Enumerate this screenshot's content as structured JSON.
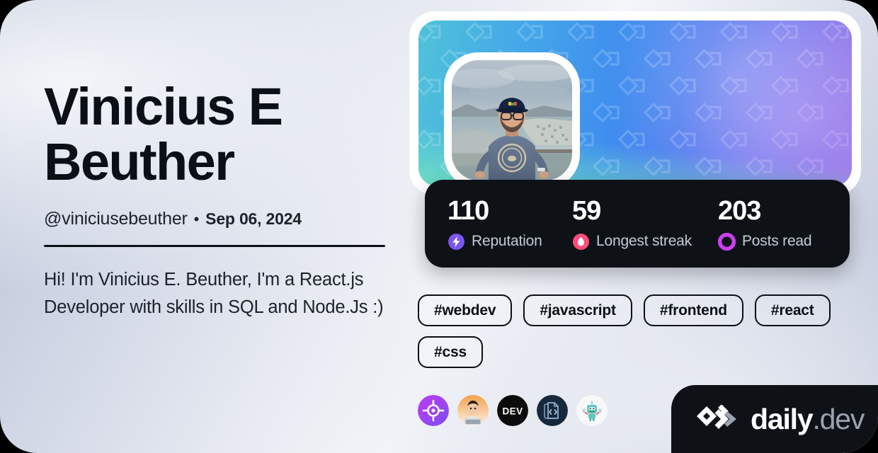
{
  "profile": {
    "name": "Vinicius E Beuther",
    "handle": "@viniciusebeuther",
    "separator": "•",
    "joined_date": "Sep 06, 2024",
    "bio": "Hi! I'm Vinicius E. Beuther, I'm a React.js Developer with skills in SQL and Node.Js :)"
  },
  "stats": [
    {
      "value": "110",
      "label": "Reputation",
      "icon": "reputation-bolt-icon",
      "color": "#7B55F0"
    },
    {
      "value": "59",
      "label": "Longest streak",
      "icon": "streak-flame-icon",
      "color": "#FF4C79"
    },
    {
      "value": "203",
      "label": "Posts read",
      "icon": "posts-read-ring-icon",
      "color": "#CE3DF3"
    }
  ],
  "tags": [
    {
      "label": "#webdev"
    },
    {
      "label": "#javascript"
    },
    {
      "label": "#frontend"
    },
    {
      "label": "#react"
    },
    {
      "label": "#css"
    }
  ],
  "socials": [
    {
      "name": "crosshair-target-icon"
    },
    {
      "name": "avatar-laptop-icon"
    },
    {
      "name": "devto-icon"
    },
    {
      "name": "code-file-icon"
    },
    {
      "name": "robot-mascot-icon"
    }
  ],
  "brand": {
    "name": "daily",
    "suffix": ".dev",
    "logo": "daily-dev-chevron-logo",
    "badge_bg": "#0E1217"
  },
  "theme": {
    "card_radius": "52px",
    "text_color": "#0B0F16",
    "panel_bg": "#0E1217",
    "cover_gradient_from": "#4FC3D9",
    "cover_gradient_to": "#9B7AE8"
  }
}
